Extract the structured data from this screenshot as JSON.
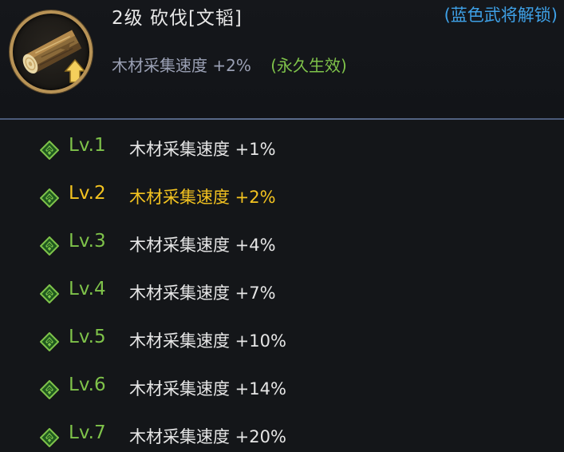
{
  "skill": {
    "title": "2级 砍伐[文韬]",
    "unlock_note": "(蓝色武将解锁)",
    "current_effect": "木材采集速度 +2%",
    "permanent_note": "(永久生效)",
    "icon": "wood-log-upgrade-icon"
  },
  "colors": {
    "level_green": "#7fc34a",
    "current_yellow": "#f3c320",
    "unlock_blue": "#3ea0e6",
    "frame_gold": "#b89356"
  },
  "levels": [
    {
      "label": "Lv.1",
      "effect": "木材采集速度 +1%",
      "current": false
    },
    {
      "label": "Lv.2",
      "effect": "木材采集速度 +2%",
      "current": true
    },
    {
      "label": "Lv.3",
      "effect": "木材采集速度 +4%",
      "current": false
    },
    {
      "label": "Lv.4",
      "effect": "木材采集速度 +7%",
      "current": false
    },
    {
      "label": "Lv.5",
      "effect": "木材采集速度 +10%",
      "current": false
    },
    {
      "label": "Lv.6",
      "effect": "木材采集速度 +14%",
      "current": false
    },
    {
      "label": "Lv.7",
      "effect": "木材采集速度 +20%",
      "current": false
    }
  ]
}
